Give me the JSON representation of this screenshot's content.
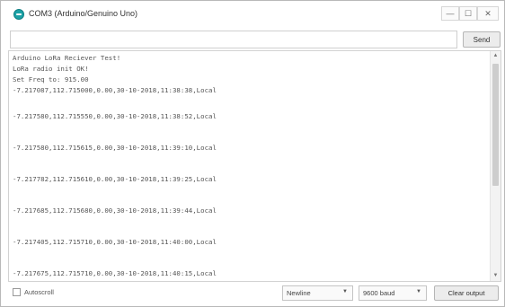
{
  "window": {
    "title": "COM3 (Arduino/Genuino Uno)",
    "controls": {
      "minimize": "—",
      "maximize": "☐",
      "close": "✕"
    }
  },
  "input": {
    "value": "",
    "send_label": "Send"
  },
  "output": {
    "lines": [
      "Arduino LoRa Reciever Test!",
      "LoRa radio init OK!",
      "Set Freq to: 915.00",
      "-7.217087,112.715000,0.00,30-10-2018,11:38:38,Local",
      "-7.217580,112.715550,0.00,30-10-2018,11:38:52,Local",
      "-7.217580,112.715615,0.00,30-10-2018,11:39:10,Local",
      "-7.217782,112.715610,0.00,30-10-2018,11:39:25,Local",
      "-7.217685,112.715680,0.00,30-10-2018,11:39:44,Local",
      "-7.217405,112.715710,0.00,30-10-2018,11:40:00,Local",
      "-7.217675,112.715710,0.00,30-10-2018,11:40:15,Local"
    ]
  },
  "footer": {
    "autoscroll_label": "Autoscroll",
    "autoscroll_checked": false,
    "line_ending": "Newline",
    "baud_rate": "9600 baud",
    "clear_label": "Clear output"
  }
}
